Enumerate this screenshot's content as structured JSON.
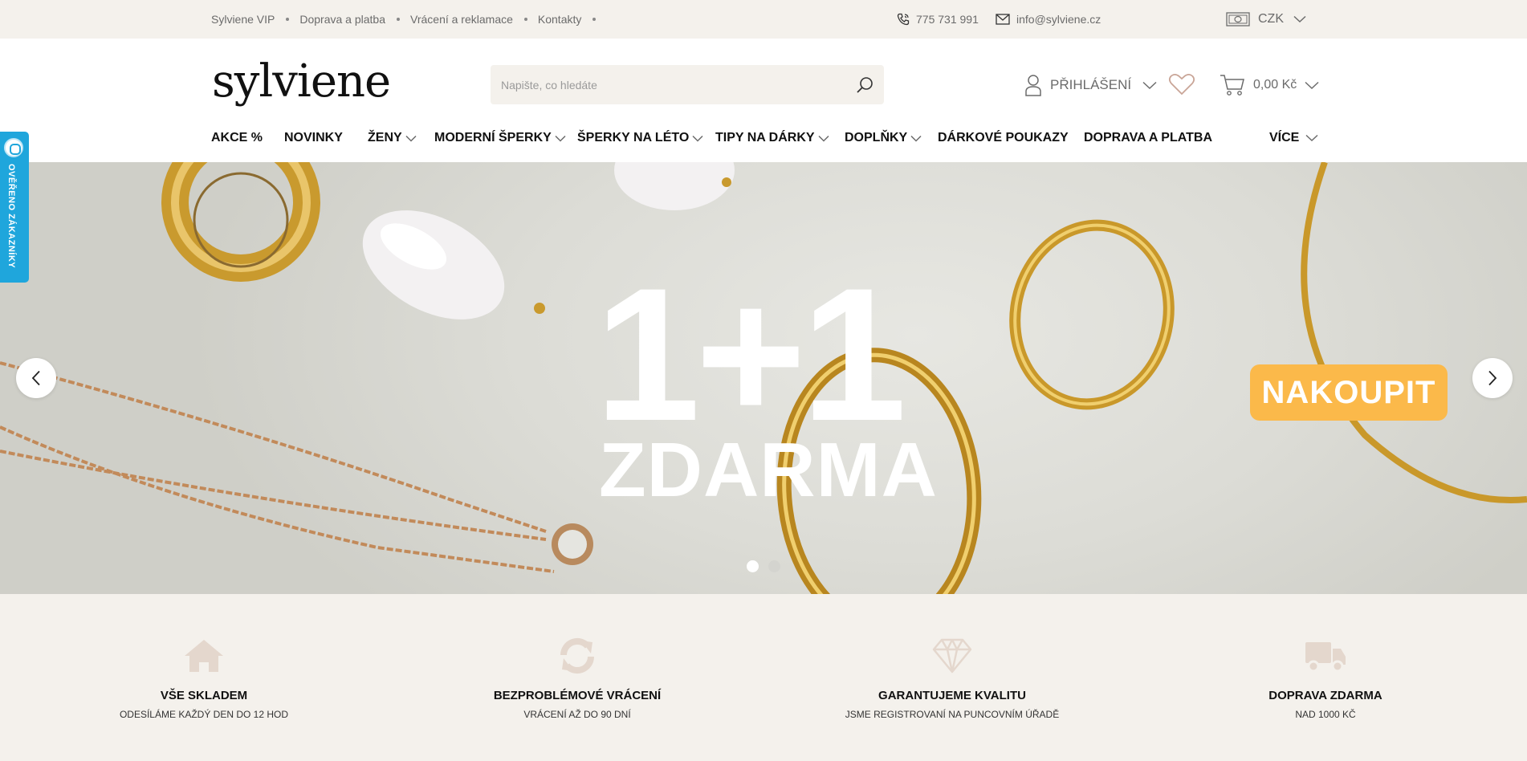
{
  "topbar": {
    "links": [
      "Sylviene VIP",
      "Doprava a platba",
      "Vrácení a reklamace",
      "Kontakty"
    ],
    "phone": "775 731 991",
    "email": "info@sylviene.cz",
    "currency": "CZK"
  },
  "header": {
    "logo": "sylviene",
    "search_placeholder": "Napište, co hledáte",
    "login_label": "PŘIHLÁŠENÍ",
    "cart_total": "0,00 Kč"
  },
  "nav": {
    "items": [
      {
        "label": "AKCE %"
      },
      {
        "label": "NOVINKY"
      },
      {
        "label": "ŽENY"
      },
      {
        "label": "MODERNÍ ŠPERKY"
      },
      {
        "label": "ŠPERKY NA LÉTO"
      },
      {
        "label": "TIPY NA DÁRKY"
      },
      {
        "label": "DOPLŇKY"
      },
      {
        "label": "DÁRKOVÉ POUKAZY"
      },
      {
        "label": "DOPRAVA A PLATBA"
      },
      {
        "label": "VÍCE"
      }
    ]
  },
  "badge": {
    "label": "OVĚŘENO ZÁKAZNÍKY"
  },
  "hero": {
    "headline": "1+1",
    "subline": "ZDARMA",
    "cta": "NAKOUPIT",
    "slides": 2,
    "active_slide": 1
  },
  "features": [
    {
      "title": "VŠE SKLADEM",
      "subtitle": "ODESÍLÁME KAŽDÝ DEN DO 12 HOD",
      "icon": "home-icon"
    },
    {
      "title": "BEZPROBLÉMOVÉ VRÁCENÍ",
      "subtitle": "VRÁCENÍ AŽ DO 90 DNÍ",
      "icon": "refresh-icon"
    },
    {
      "title": "GARANTUJEME KVALITU",
      "subtitle": "JSME REGISTROVANÍ NA PUNCOVNÍM ÚŘADĚ",
      "icon": "diamond-icon"
    },
    {
      "title": "DOPRAVA ZDARMA",
      "subtitle": "NAD 1000 KČ",
      "icon": "truck-icon"
    }
  ],
  "colors": {
    "topbar_bg": "#f4f1ec",
    "cta": "#fbb94a",
    "badge": "#1fa6dc",
    "feature_icon": "#e4d7cd"
  }
}
